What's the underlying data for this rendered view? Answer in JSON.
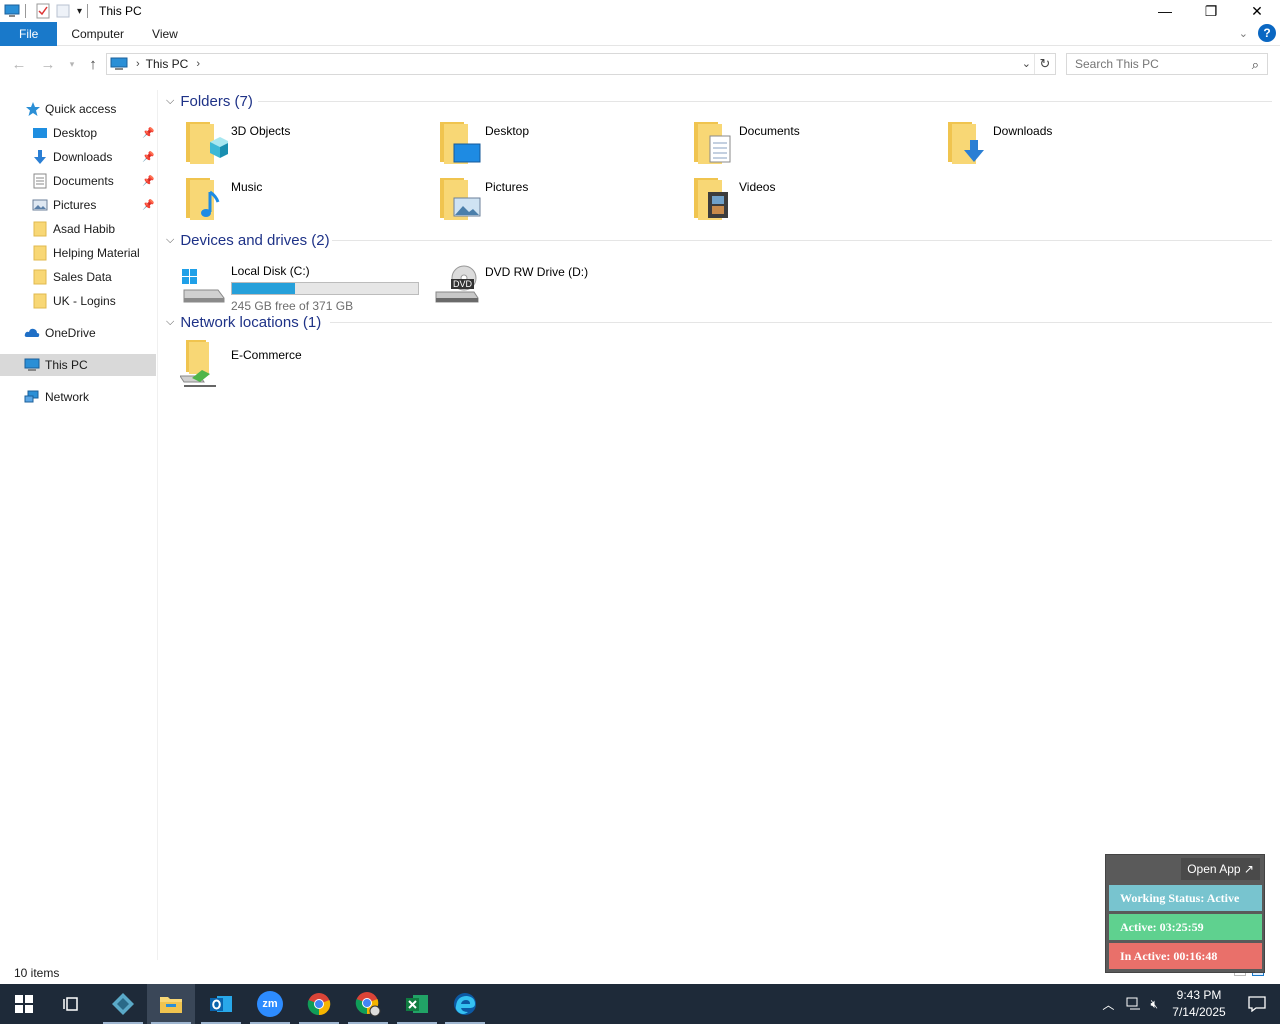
{
  "window": {
    "title": "This PC",
    "minimize": "—",
    "maximize": "❐",
    "close": "✕"
  },
  "ribbon": {
    "tabs": [
      "File",
      "Computer",
      "View"
    ]
  },
  "address": {
    "crumb": "This PC",
    "chevron": "›"
  },
  "search": {
    "placeholder": "Search This PC"
  },
  "sidebar": {
    "quick_access": "Quick access",
    "items": [
      {
        "label": "Desktop",
        "pinned": true
      },
      {
        "label": "Downloads",
        "pinned": true
      },
      {
        "label": "Documents",
        "pinned": true
      },
      {
        "label": "Pictures",
        "pinned": true
      },
      {
        "label": "Asad Habib",
        "pinned": false
      },
      {
        "label": "Helping Material",
        "pinned": false
      },
      {
        "label": "Sales Data",
        "pinned": false
      },
      {
        "label": "UK - Logins",
        "pinned": false
      }
    ],
    "onedrive": "OneDrive",
    "this_pc": "This PC",
    "network": "Network"
  },
  "groups": {
    "folders": {
      "header": "Folders (7)",
      "items": [
        "3D Objects",
        "Desktop",
        "Documents",
        "Downloads",
        "Music",
        "Pictures",
        "Videos"
      ]
    },
    "devices": {
      "header": "Devices and drives (2)",
      "local_disk": {
        "name": "Local Disk (C:)",
        "free": "245 GB free of 371 GB",
        "used_fraction": 0.34
      },
      "dvd": {
        "name": "DVD RW Drive (D:)",
        "badge": "DVD"
      }
    },
    "network": {
      "header": "Network locations (1)",
      "items": [
        "E-Commerce"
      ]
    }
  },
  "status": {
    "count": "10 items"
  },
  "widget": {
    "open_app": "Open App ↗",
    "working_status": "Working Status: Active",
    "active": "Active: 03:25:59",
    "inactive": "In Active: 00:16:48",
    "colors": {
      "status": "#78c4cf",
      "active": "#5fd18f",
      "inactive": "#e9706a"
    }
  },
  "taskbar": {
    "time": "9:43 PM",
    "date": "7/14/2025",
    "apps": [
      "start-icon",
      "task-view-icon",
      "app-icon",
      "file-explorer-icon",
      "outlook-icon",
      "zoom-icon",
      "chrome-icon",
      "chrome-profile-icon",
      "excel-icon",
      "edge-icon"
    ],
    "zoom_label": "zm"
  }
}
